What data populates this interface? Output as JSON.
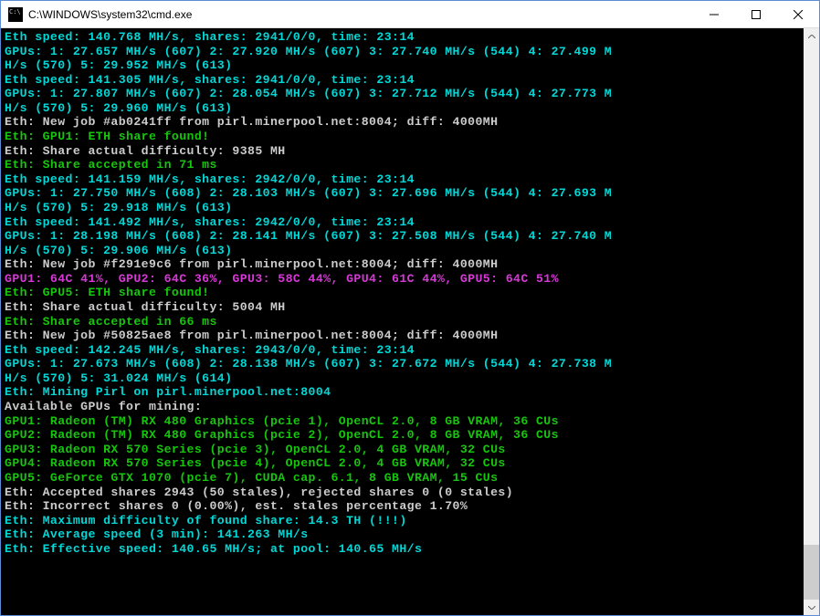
{
  "window": {
    "title": "C:\\WINDOWS\\system32\\cmd.exe"
  },
  "colors": {
    "cyan": "#00d8d8",
    "green": "#16c60c",
    "white": "#cccccc",
    "magenta": "#d838d8",
    "bg": "#000"
  },
  "lines": [
    {
      "cls": "c-cyan",
      "t": "Eth speed: 140.768 MH/s, shares: 2941/0/0, time: 23:14"
    },
    {
      "cls": "c-cyan",
      "t": "GPUs: 1: 27.657 MH/s (607) 2: 27.920 MH/s (607) 3: 27.740 MH/s (544) 4: 27.499 M"
    },
    {
      "cls": "c-cyan",
      "t": "H/s (570) 5: 29.952 MH/s (613)"
    },
    {
      "cls": "c-cyan",
      "t": "Eth speed: 141.305 MH/s, shares: 2941/0/0, time: 23:14"
    },
    {
      "cls": "c-cyan",
      "t": "GPUs: 1: 27.807 MH/s (607) 2: 28.054 MH/s (607) 3: 27.712 MH/s (544) 4: 27.773 M"
    },
    {
      "cls": "c-cyan",
      "t": "H/s (570) 5: 29.960 MH/s (613)"
    },
    {
      "cls": "c-white",
      "t": "Eth: New job #ab0241ff from pirl.minerpool.net:8004; diff: 4000MH"
    },
    {
      "cls": "c-green",
      "t": "Eth: GPU1: ETH share found!"
    },
    {
      "cls": "c-white",
      "t": "Eth: Share actual difficulty: 9385 MH"
    },
    {
      "cls": "c-green",
      "t": "Eth: Share accepted in 71 ms"
    },
    {
      "cls": "c-cyan",
      "t": "Eth speed: 141.159 MH/s, shares: 2942/0/0, time: 23:14"
    },
    {
      "cls": "c-cyan",
      "t": "GPUs: 1: 27.750 MH/s (608) 2: 28.103 MH/s (607) 3: 27.696 MH/s (544) 4: 27.693 M"
    },
    {
      "cls": "c-cyan",
      "t": "H/s (570) 5: 29.918 MH/s (613)"
    },
    {
      "cls": "c-cyan",
      "t": "Eth speed: 141.492 MH/s, shares: 2942/0/0, time: 23:14"
    },
    {
      "cls": "c-cyan",
      "t": "GPUs: 1: 28.198 MH/s (608) 2: 28.141 MH/s (607) 3: 27.508 MH/s (544) 4: 27.740 M"
    },
    {
      "cls": "c-cyan",
      "t": "H/s (570) 5: 29.906 MH/s (613)"
    },
    {
      "cls": "c-white",
      "t": "Eth: New job #f291e9c6 from pirl.minerpool.net:8004; diff: 4000MH"
    },
    {
      "cls": "c-magenta",
      "t": "GPU1: 64C 41%, GPU2: 64C 36%, GPU3: 58C 44%, GPU4: 61C 44%, GPU5: 64C 51%"
    },
    {
      "cls": "c-green",
      "t": "Eth: GPU5: ETH share found!"
    },
    {
      "cls": "c-white",
      "t": "Eth: Share actual difficulty: 5004 MH"
    },
    {
      "cls": "c-green",
      "t": "Eth: Share accepted in 66 ms"
    },
    {
      "cls": "c-white",
      "t": "Eth: New job #50825ae8 from pirl.minerpool.net:8004; diff: 4000MH"
    },
    {
      "cls": "c-cyan",
      "t": "Eth speed: 142.245 MH/s, shares: 2943/0/0, time: 23:14"
    },
    {
      "cls": "c-cyan",
      "t": "GPUs: 1: 27.673 MH/s (608) 2: 28.138 MH/s (607) 3: 27.672 MH/s (544) 4: 27.738 M"
    },
    {
      "cls": "c-cyan",
      "t": "H/s (570) 5: 31.024 MH/s (614)"
    },
    {
      "cls": "c-cyan",
      "t": ""
    },
    {
      "cls": "c-cyan",
      "t": "Eth: Mining Pirl on pirl.minerpool.net:8004"
    },
    {
      "cls": "c-white",
      "t": "Available GPUs for mining:"
    },
    {
      "cls": "c-green",
      "t": "GPU1: Radeon (TM) RX 480 Graphics (pcie 1), OpenCL 2.0, 8 GB VRAM, 36 CUs"
    },
    {
      "cls": "c-green",
      "t": "GPU2: Radeon (TM) RX 480 Graphics (pcie 2), OpenCL 2.0, 8 GB VRAM, 36 CUs"
    },
    {
      "cls": "c-green",
      "t": "GPU3: Radeon RX 570 Series (pcie 3), OpenCL 2.0, 4 GB VRAM, 32 CUs"
    },
    {
      "cls": "c-green",
      "t": "GPU4: Radeon RX 570 Series (pcie 4), OpenCL 2.0, 4 GB VRAM, 32 CUs"
    },
    {
      "cls": "c-green",
      "t": "GPU5: GeForce GTX 1070 (pcie 7), CUDA cap. 6.1, 8 GB VRAM, 15 CUs"
    },
    {
      "cls": "c-white",
      "t": "Eth: Accepted shares 2943 (50 stales), rejected shares 0 (0 stales)"
    },
    {
      "cls": "c-white",
      "t": "Eth: Incorrect shares 0 (0.00%), est. stales percentage 1.70%"
    },
    {
      "cls": "c-cyan",
      "t": "Eth: Maximum difficulty of found share: 14.3 TH (!!!)"
    },
    {
      "cls": "c-cyan",
      "t": "Eth: Average speed (3 min): 141.263 MH/s"
    },
    {
      "cls": "c-cyan",
      "t": "Eth: Effective speed: 140.65 MH/s; at pool: 140.65 MH/s"
    }
  ]
}
